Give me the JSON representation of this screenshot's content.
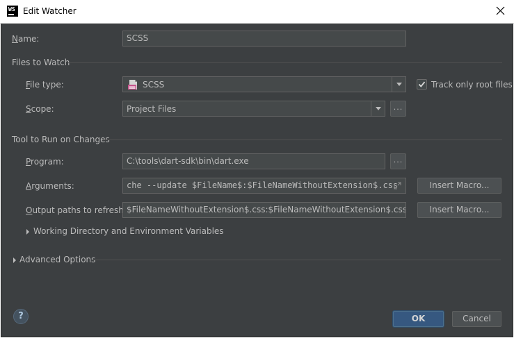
{
  "window": {
    "title": "Edit Watcher"
  },
  "name": {
    "label_first": "N",
    "label_rest": "ame:",
    "value": "SCSS"
  },
  "files_to_watch": {
    "title": "Files to Watch",
    "file_type": {
      "label_first": "F",
      "label_rest": "ile type:",
      "value": "SCSS"
    },
    "track_root": {
      "label": "Track only root files",
      "checked": true
    },
    "scope": {
      "label_first": "S",
      "label_rest": "cope:",
      "value": "Project Files",
      "browse_label": "..."
    }
  },
  "tool": {
    "title": "Tool to Run on Changes",
    "program": {
      "label_first": "P",
      "label_rest": "rogram:",
      "value": "C:\\tools\\dart-sdk\\bin\\dart.exe",
      "browse_label": "..."
    },
    "arguments": {
      "label_first": "A",
      "label_rest": "rguments:",
      "value": "che --update $FileName$:$FileNameWithoutExtension$.css",
      "macro_label": "Insert Macro..."
    },
    "output": {
      "label_first": "O",
      "label_rest": "utput paths to refresh:",
      "value": "$FileNameWithoutExtension$.css:$FileNameWithoutExtension$.css.map",
      "macro_label": "Insert Macro..."
    },
    "working_dir": {
      "label": "Working Directory and Environment Variables"
    }
  },
  "advanced": {
    "label": "Advanced Options"
  },
  "footer": {
    "help_label": "?",
    "ok_label": "OK",
    "cancel_label": "Cancel"
  },
  "colors": {
    "background": "#3c3f41",
    "field": "#45494a",
    "primary": "#365880",
    "scss_badge": "#c6538c"
  }
}
